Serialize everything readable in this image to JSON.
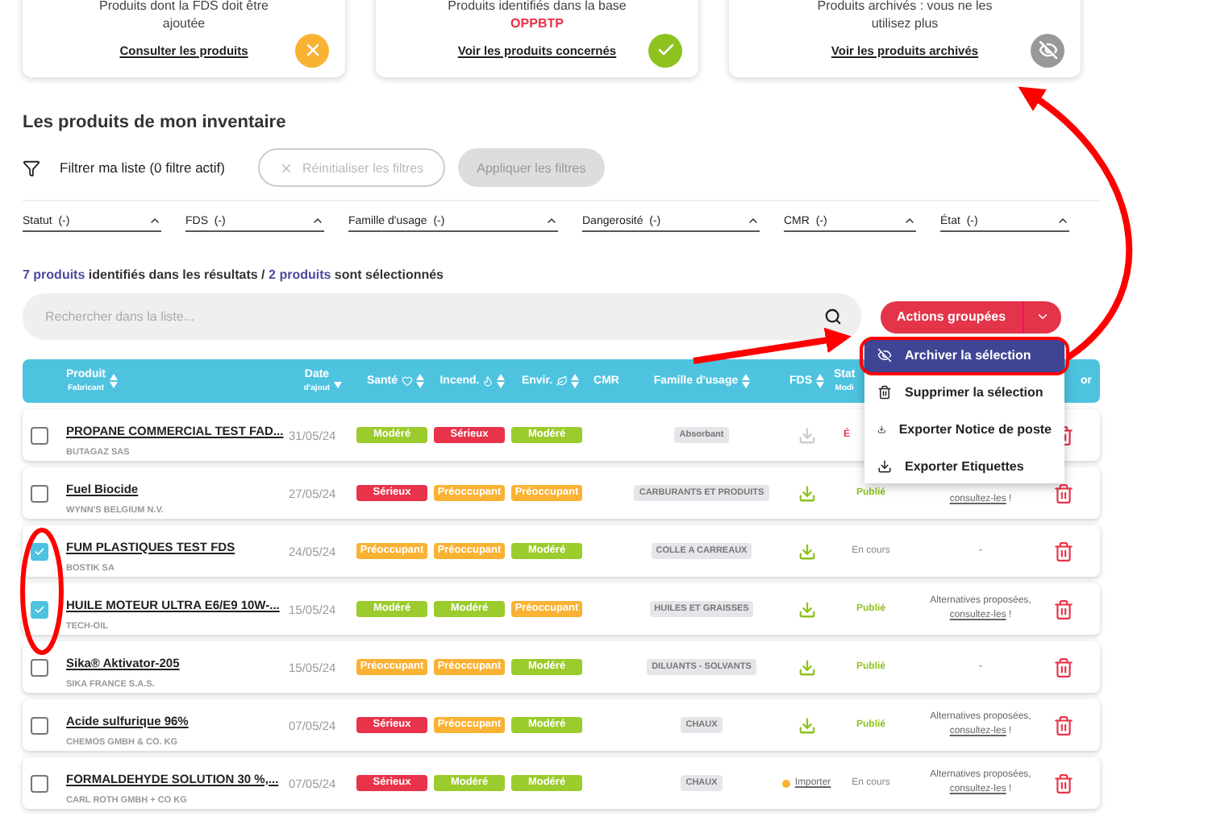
{
  "cards": [
    {
      "kind": "warning",
      "text": "Produits dont la FDS doit être ajoutée",
      "link": "Consulter les produits"
    },
    {
      "kind": "success",
      "text": "Produits identifiés dans la base",
      "highlight": "OPPBTP",
      "link": "Voir les produits concernés"
    },
    {
      "kind": "archived",
      "text": "Produits archivés : vous ne les utilisez plus",
      "link": "Voir les produits archivés"
    }
  ],
  "section_title": "Les produits de mon inventaire",
  "filter_label": "Filtrer ma liste (0 filtre actif)",
  "reset_button": {
    "label": "Réinitialiser les filtres",
    "disabled": true
  },
  "apply_button": {
    "label": "Appliquer les filtres",
    "disabled": true
  },
  "filters": [
    {
      "label": "Statut",
      "value": "(-)"
    },
    {
      "label": "FDS",
      "value": "(-)"
    },
    {
      "label": "Famille d'usage",
      "value": "(-)"
    },
    {
      "label": "Dangerosité",
      "value": "(-)"
    },
    {
      "label": "CMR",
      "value": "(-)"
    },
    {
      "label": "État",
      "value": "(-)"
    }
  ],
  "summary": {
    "total": "7 produits",
    "middle": "identifiés dans les résultats /",
    "selected": "2 produits",
    "end": "sont sélectionnés"
  },
  "search": {
    "placeholder": "Rechercher dans la liste..."
  },
  "actions_button": "Actions groupées",
  "menu": [
    {
      "label": "Archiver la sélection",
      "kind": "archive",
      "selected": true
    },
    {
      "label": "Supprimer la sélection",
      "kind": "delete",
      "selected": false
    },
    {
      "label": "Exporter Notice de poste",
      "kind": "export",
      "selected": false
    },
    {
      "label": "Exporter Etiquettes",
      "kind": "export",
      "selected": false
    }
  ],
  "columns": [
    {
      "label": "Produit",
      "sub": "Fabricant",
      "sort_up": true,
      "sort_down": true,
      "wide": false,
      "kind": "text"
    },
    {
      "label": "Date",
      "sub": "d'ajout",
      "sort_up": false,
      "sort_down": true,
      "wide": false,
      "kind": "text"
    },
    {
      "label": "Santé",
      "sort_up": true,
      "sort_down": true,
      "wide": false,
      "kind": "health"
    },
    {
      "label": "Incend.",
      "sort_up": true,
      "sort_down": true,
      "wide": false,
      "kind": "fire"
    },
    {
      "label": "Envir.",
      "sort_up": true,
      "sort_down": true,
      "wide": false,
      "kind": "env"
    },
    {
      "label": "CMR",
      "sort_up": false,
      "sort_down": false,
      "wide": false,
      "kind": "text"
    },
    {
      "label": "Famille d'usage",
      "sort_up": true,
      "sort_down": true,
      "wide": false,
      "kind": "text"
    },
    {
      "label": "FDS",
      "sort_up": true,
      "sort_down": true,
      "wide": false,
      "kind": "text"
    },
    {
      "label": "Stat",
      "sub": "Modi",
      "sort_up": false,
      "sort_down": false,
      "wide": true,
      "kind": "text"
    },
    {
      "label": "or",
      "sort_up": false,
      "sort_down": false,
      "wide": false,
      "kind": "text"
    }
  ],
  "rows": [
    {
      "selected": false,
      "name": "PROPANE COMMERCIAL TEST FAD...",
      "maker": "BUTAGAZ SAS",
      "date": "31/05/24",
      "badges": [
        {
          "text": "Modéré",
          "kind": "moderate"
        },
        {
          "text": "Sérieux",
          "kind": "serious"
        },
        {
          "text": "Modéré",
          "kind": "moderate"
        }
      ],
      "family": "Absorbant",
      "fds": {
        "kind": "download",
        "disabled": true
      },
      "status": {
        "text": "É",
        "kind": "error"
      }
    },
    {
      "selected": false,
      "name": "Fuel Biocide",
      "maker": "WYNN'S BELGIUM N.V.",
      "date": "27/05/24",
      "badges": [
        {
          "text": "Sérieux",
          "kind": "serious"
        },
        {
          "text": "Préoccupant",
          "kind": "concerning"
        },
        {
          "text": "Préoccupant",
          "kind": "concerning"
        }
      ],
      "family": "CARBURANTS ET PRODUITS",
      "fds": {
        "kind": "download",
        "disabled": false
      },
      "status": {
        "text": "Publié",
        "kind": "published"
      },
      "alt": {
        "link": "consultez-les",
        "end": "!"
      }
    },
    {
      "selected": true,
      "name": "FUM PLASTIQUES TEST FDS",
      "maker": "BOSTIK SA",
      "date": "24/05/24",
      "badges": [
        {
          "text": "Préoccupant",
          "kind": "concerning"
        },
        {
          "text": "Préoccupant",
          "kind": "concerning"
        },
        {
          "text": "Modéré",
          "kind": "moderate"
        }
      ],
      "family": "COLLE A CARREAUX",
      "fds": {
        "kind": "download",
        "disabled": false
      },
      "status": {
        "text": "En cours",
        "kind": "pending"
      },
      "alt": {
        "text": "-"
      }
    },
    {
      "selected": true,
      "name": "HUILE MOTEUR ULTRA E6/E9 10W-...",
      "maker": "TECH-OIL",
      "date": "15/05/24",
      "badges": [
        {
          "text": "Modéré",
          "kind": "moderate"
        },
        {
          "text": "Modéré",
          "kind": "moderate"
        },
        {
          "text": "Préoccupant",
          "kind": "concerning"
        }
      ],
      "family": "HUILES ET GRAISSES",
      "fds": {
        "kind": "download",
        "disabled": false
      },
      "status": {
        "text": "Publié",
        "kind": "published"
      },
      "alt": {
        "text": "Alternatives proposées,",
        "link": "consultez-les",
        "end": "!"
      }
    },
    {
      "selected": false,
      "name": "Sika® Aktivator-205",
      "maker": "SIKA FRANCE S.A.S.",
      "date": "15/05/24",
      "badges": [
        {
          "text": "Préoccupant",
          "kind": "concerning"
        },
        {
          "text": "Préoccupant",
          "kind": "concerning"
        },
        {
          "text": "Modéré",
          "kind": "moderate"
        }
      ],
      "family": "DILUANTS - SOLVANTS",
      "fds": {
        "kind": "download",
        "disabled": false
      },
      "status": {
        "text": "Publié",
        "kind": "published"
      },
      "alt": {
        "text": "-"
      }
    },
    {
      "selected": false,
      "name": "Acide sulfurique 96%",
      "maker": "CHEMOS GMBH & CO. KG",
      "date": "07/05/24",
      "badges": [
        {
          "text": "Sérieux",
          "kind": "serious"
        },
        {
          "text": "Préoccupant",
          "kind": "concerning"
        },
        {
          "text": "Modéré",
          "kind": "moderate"
        }
      ],
      "family": "CHAUX",
      "fds": {
        "kind": "download",
        "disabled": false
      },
      "status": {
        "text": "Publié",
        "kind": "published"
      },
      "alt": {
        "text": "Alternatives proposées,",
        "link": "consultez-les",
        "end": "!"
      }
    },
    {
      "selected": false,
      "name": "FORMALDEHYDE SOLUTION 30 %,...",
      "maker": "CARL ROTH GMBH + CO KG",
      "date": "07/05/24",
      "badges": [
        {
          "text": "Sérieux",
          "kind": "serious"
        },
        {
          "text": "Modéré",
          "kind": "moderate"
        },
        {
          "text": "Modéré",
          "kind": "moderate"
        }
      ],
      "family": "CHAUX",
      "fds": {
        "kind": "import",
        "label": "Importer"
      },
      "status": {
        "text": "En cours",
        "kind": "pending"
      },
      "alt": {
        "text": "Alternatives proposées,",
        "link": "consultez-les",
        "end": "!"
      }
    }
  ]
}
